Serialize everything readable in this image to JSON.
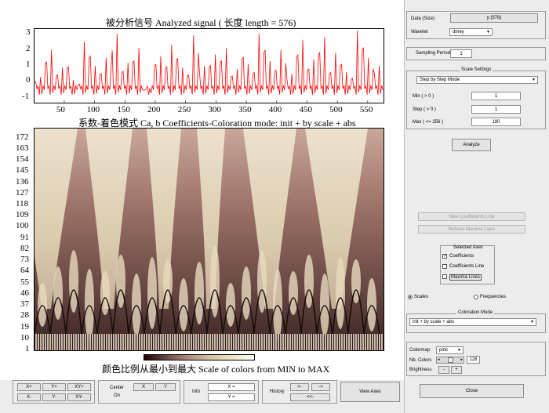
{
  "signal_plot": {
    "title": "被分析信号 Analyzed signal ( 长度 length  = 576)",
    "x_ticks": [
      "50",
      "100",
      "150",
      "200",
      "250",
      "300",
      "350",
      "400",
      "450",
      "500",
      "550"
    ],
    "y_ticks": [
      "3",
      "2",
      "1",
      "0",
      "-1"
    ],
    "line_color": "#ff0000"
  },
  "coef_plot": {
    "title": "系数-着色模式  Ca, b Coefficients-Coloration mode: init + by scale + abs",
    "y_ticks": [
      "172",
      "163",
      "154",
      "145",
      "136",
      "127",
      "118",
      "109",
      "100",
      "91",
      "82",
      "73",
      "64",
      "55",
      "46",
      "37",
      "28",
      "19",
      "10",
      "1"
    ]
  },
  "colorbar": {
    "title": "颜色比例从最小到最大  Scale of colors from MIN to MAX"
  },
  "chart_data": [
    {
      "type": "line",
      "title": "被分析信号 Analyzed signal ( 长度 length  = 576)",
      "xlim": [
        1,
        576
      ],
      "ylim": [
        -1.3,
        3.3
      ],
      "x_ticks": [
        50,
        100,
        150,
        200,
        250,
        300,
        350,
        400,
        450,
        500,
        550
      ],
      "y_ticks": [
        3,
        2,
        1,
        0,
        -1
      ],
      "series": [
        {
          "x_step": 16,
          "y": [
            0.3,
            2.0,
            0.9,
            1.6,
            0.1,
            2.5,
            1.0,
            1.5,
            3.0,
            1.2,
            2.1,
            -0.4,
            1.8,
            1.6,
            2.3,
            0.9,
            2.9,
            1.0,
            1.7,
            2.1,
            0.8,
            2.4,
            1.1,
            3.0,
            1.3,
            2.0,
            0.5,
            2.6,
            1.4,
            2.8,
            1.1,
            1.8,
            0.6,
            3.2,
            1.5,
            1.0
          ]
        }
      ]
    },
    {
      "type": "heatmap",
      "title": "系数-着色模式  Ca, b Coefficients-Coloration mode: init + by scale + abs",
      "xlim": [
        1,
        576
      ],
      "ylim": [
        1,
        180
      ],
      "y_ticks": [
        172,
        163,
        154,
        145,
        136,
        127,
        118,
        109,
        100,
        91,
        82,
        73,
        64,
        55,
        46,
        37,
        28,
        19,
        10,
        1
      ],
      "colormap": "pink"
    }
  ],
  "panel": {
    "data_label": "Data (Size)",
    "data_value": "y (576)",
    "wavelet_label": "Wavelet",
    "wavelet_value": "dmey",
    "sampling_label": "Sampling Period",
    "sampling_value": "1",
    "scale_settings_title": "Scale Settings",
    "scale_mode": "Step by Step Mode",
    "min_label": "Min  ( > 0 )",
    "min_value": "1",
    "step_label": "Step ( > 0 )",
    "step_value": "1",
    "max_label": "Max  ( <= 256 )",
    "max_value": "180",
    "analyze_label": "Analyze",
    "new_coef_line_label": "New Coefficients Line",
    "refresh_maxima_label": "Refresh Maxima Lines",
    "selected_axes_title": "Selected Axes",
    "axes_coefficients": "Coefficients",
    "axes_coef_line": "Coefficients Line",
    "axes_maxima_lines": "Maxima Lines",
    "radio_scales": "Scales",
    "radio_frequencies": "Frequencies",
    "coloration_title": "Coloration Mode",
    "coloration_value": "init + by scale + abs",
    "colormap_label": "Colormap",
    "colormap_value": "pink",
    "nb_colors_label": "Nb. Colors",
    "nb_colors_value": "128",
    "brightness_label": "Brightness",
    "brightness_minus": "-",
    "brightness_plus": "+",
    "close_label": "Close"
  },
  "toolbar": {
    "xplus": "X+",
    "yplus": "Y+",
    "xyplus": "XY+",
    "xminus": "X-",
    "yminus": "Y-",
    "xyminus": "XY-",
    "center_label": "Center",
    "on_label": "On",
    "center_x": "X",
    "center_y": "Y",
    "info_label": "Info",
    "info_x": "X =",
    "info_y": "Y =",
    "history_label": "History",
    "hist_back": "<-",
    "hist_fwd": "->",
    "hist_reset": "<<-",
    "view_axes": "View Axes"
  }
}
